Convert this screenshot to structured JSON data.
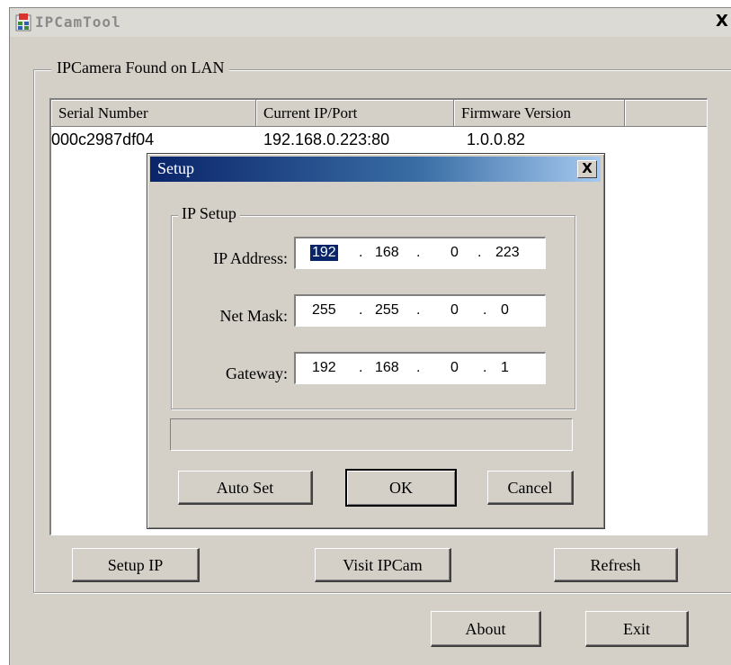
{
  "window": {
    "title": "IPCamTool",
    "close_label": "X"
  },
  "group": {
    "label": "IPCamera Found on LAN"
  },
  "list": {
    "columns": [
      "Serial Number",
      "Current IP/Port",
      "Firmware Version"
    ],
    "rows": [
      {
        "serial": "000c2987df04",
        "ip_port": "192.168.0.223:80",
        "firmware": "1.0.0.82"
      }
    ]
  },
  "buttons": {
    "setup_ip": "Setup IP",
    "visit_ipcam": "Visit IPCam",
    "refresh": "Refresh",
    "about": "About",
    "exit": "Exit"
  },
  "dialog": {
    "title": "Setup",
    "close_label": "X",
    "group_label": "IP Setup",
    "fields": {
      "ip": {
        "label": "IP Address:",
        "octets": [
          "192",
          "168",
          "0",
          "223"
        ]
      },
      "mask": {
        "label": "Net Mask:",
        "octets": [
          "255",
          "255",
          "0",
          "0"
        ]
      },
      "gateway": {
        "label": "Gateway:",
        "octets": [
          "192",
          "168",
          "0",
          "1"
        ]
      }
    },
    "separator": ".",
    "buttons": {
      "auto_set": "Auto Set",
      "ok": "OK",
      "cancel": "Cancel"
    }
  }
}
